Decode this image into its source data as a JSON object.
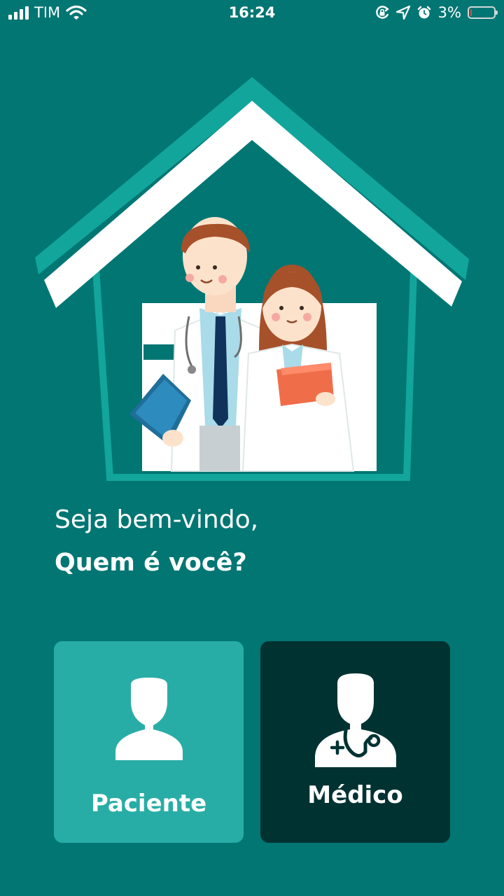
{
  "status_bar": {
    "carrier": "TIM",
    "time": "16:24",
    "battery_text": "3%",
    "battery_level": 0.03
  },
  "icons": {
    "signal": "signal-bars-icon",
    "wifi": "wifi-icon",
    "rotation_lock": "rotation-lock-icon",
    "location": "location-arrow-icon",
    "alarm": "alarm-clock-icon",
    "battery": "battery-icon",
    "patient": "person-icon",
    "doctor": "doctor-stethoscope-icon"
  },
  "colors": {
    "background": "#017673",
    "patient_card": "#28ada6",
    "doctor_card": "#003232",
    "house_outline": "#12a59c"
  },
  "greeting": {
    "line1": "Seja bem-vindo,",
    "line2": "Quem é você?"
  },
  "roles": {
    "patient_label": "Paciente",
    "doctor_label": "Médico"
  }
}
